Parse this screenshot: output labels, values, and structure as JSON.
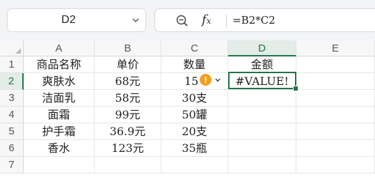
{
  "name_box": {
    "value": "D2"
  },
  "formula_bar": {
    "fx_label": "f",
    "fx_sub": "x",
    "formula": "=B2*C2"
  },
  "columns": [
    "A",
    "B",
    "C",
    "D",
    "E"
  ],
  "rows": [
    "1",
    "2",
    "3",
    "4",
    "5",
    "6",
    "7"
  ],
  "cells": [
    [
      "商品名称",
      "单价",
      "数量",
      "金额",
      ""
    ],
    [
      "爽肤水",
      "68元",
      "15",
      "#VALUE!",
      ""
    ],
    [
      "洁面乳",
      "58元",
      "30支",
      "",
      ""
    ],
    [
      "面霜",
      "99元",
      "50罐",
      "",
      ""
    ],
    [
      "护手霜",
      "36.9元",
      "20支",
      "",
      ""
    ],
    [
      "香水",
      "123元",
      "35瓶",
      "",
      ""
    ],
    [
      "",
      "",
      "",
      "",
      ""
    ]
  ],
  "error_indicator": {
    "symbol": "!",
    "color": "#f0a020"
  },
  "colors": {
    "accent": "#217346"
  }
}
